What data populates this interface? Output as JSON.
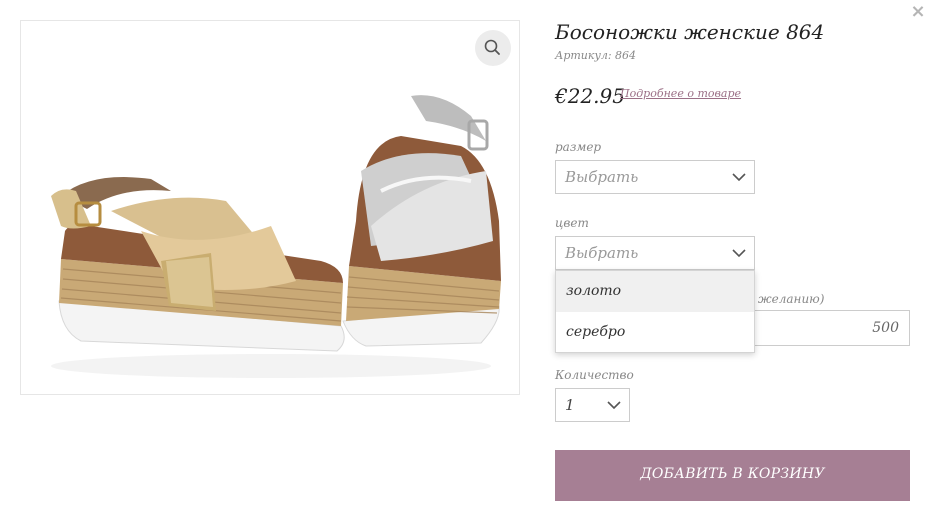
{
  "modal": {
    "close_icon": "close-icon",
    "close_glyph": "×"
  },
  "product": {
    "title": "Босоножки женские 864",
    "sku_label": "Артикул:",
    "sku_value": "864",
    "price": "€22.95",
    "details_link": "Подробнее о товаре",
    "zoom_icon": "zoom-icon"
  },
  "options": {
    "size": {
      "label": "размер",
      "value": "Выбрать"
    },
    "color": {
      "label": "цвет",
      "value": "Выбрать",
      "expanded": true,
      "options": [
        "золото",
        "серебро"
      ],
      "highlighted_index": 0
    },
    "wish": {
      "label_partial": "желанию)",
      "value": "500"
    },
    "quantity": {
      "label": "Количество",
      "value": "1"
    }
  },
  "cart": {
    "add_label": "ДОБАВИТЬ В КОРЗИНУ"
  },
  "colors": {
    "accent": "#a67f94",
    "link": "#9b6f86",
    "border": "#cccccc"
  }
}
